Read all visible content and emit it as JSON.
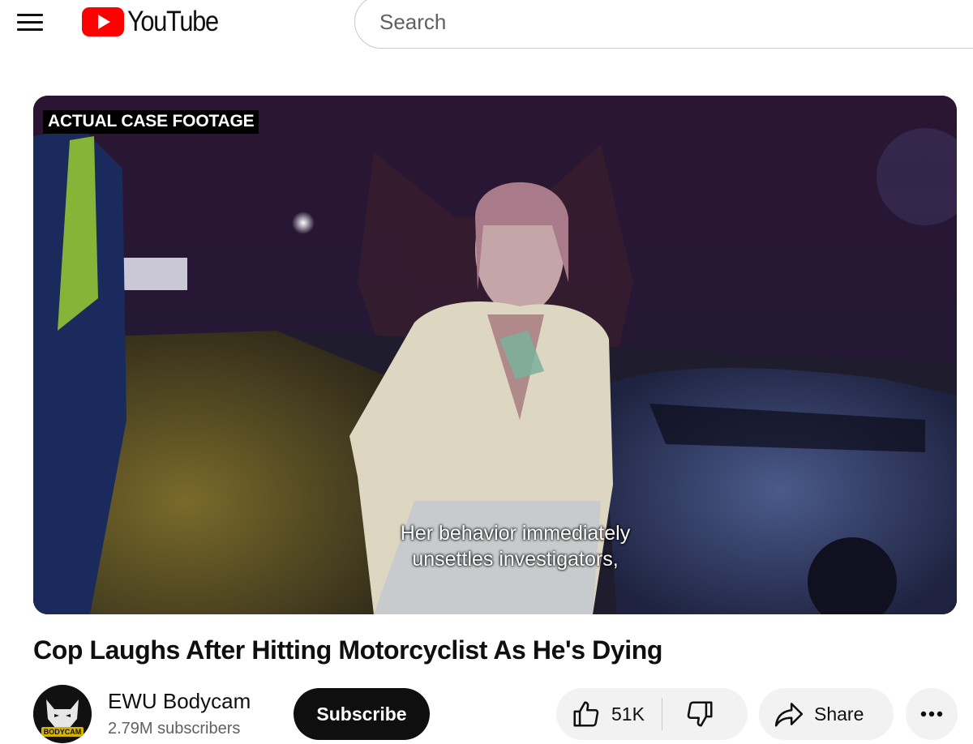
{
  "header": {
    "logo_text": "YouTube",
    "search_placeholder": "Search"
  },
  "video": {
    "badge": "ACTUAL CASE FOOTAGE",
    "caption_line1": "Her behavior immediately",
    "caption_line2": "unsettles investigators,",
    "title": "Cop Laughs After Hitting Motorcyclist As He's Dying"
  },
  "channel": {
    "name": "EWU Bodycam",
    "subscribers": "2.79M subscribers",
    "avatar_text": "BODYCAM"
  },
  "actions": {
    "subscribe_label": "Subscribe",
    "like_count": "51K",
    "share_label": "Share"
  },
  "colors": {
    "brand_red": "#ff0000",
    "text_primary": "#0f0f0f",
    "text_secondary": "#606060",
    "pill_bg": "#f2f2f2"
  },
  "icons": {
    "menu": "hamburger-menu-icon",
    "logo": "youtube-play-icon",
    "like": "thumbs-up-icon",
    "dislike": "thumbs-down-icon",
    "share": "share-arrow-icon",
    "more": "more-horizontal-icon"
  }
}
